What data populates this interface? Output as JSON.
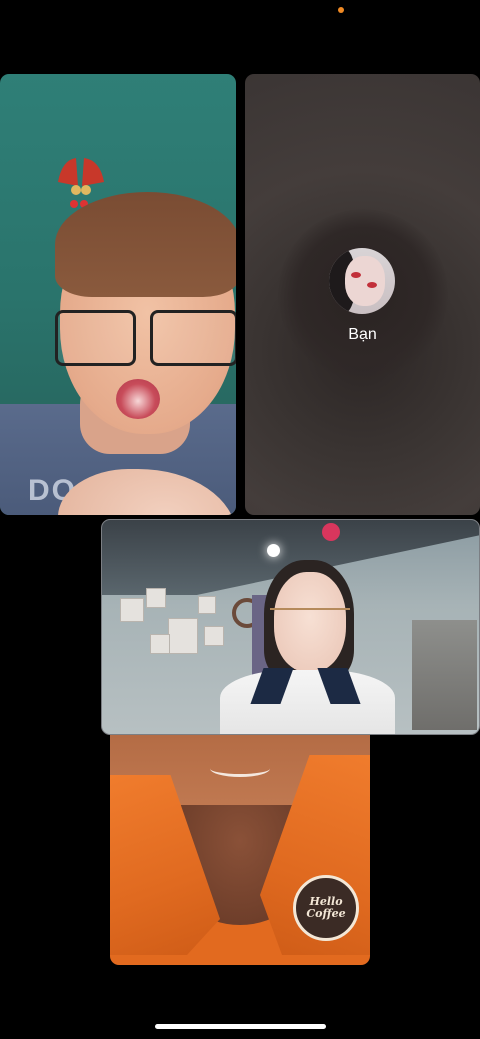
{
  "participants": [
    {
      "id": "participant-1",
      "shirt_text": "DO SO"
    },
    {
      "id": "self",
      "label": "Bạn"
    },
    {
      "id": "participant-3"
    },
    {
      "id": "participant-4",
      "badge_text": "Hello Coffee"
    }
  ],
  "colors": {
    "status_dot": "#f08a24",
    "background": "#000000",
    "home_indicator": "#ffffff"
  },
  "icons": {
    "self_avatar": "user-avatar-photo",
    "status": "orange-dot-indicator"
  }
}
